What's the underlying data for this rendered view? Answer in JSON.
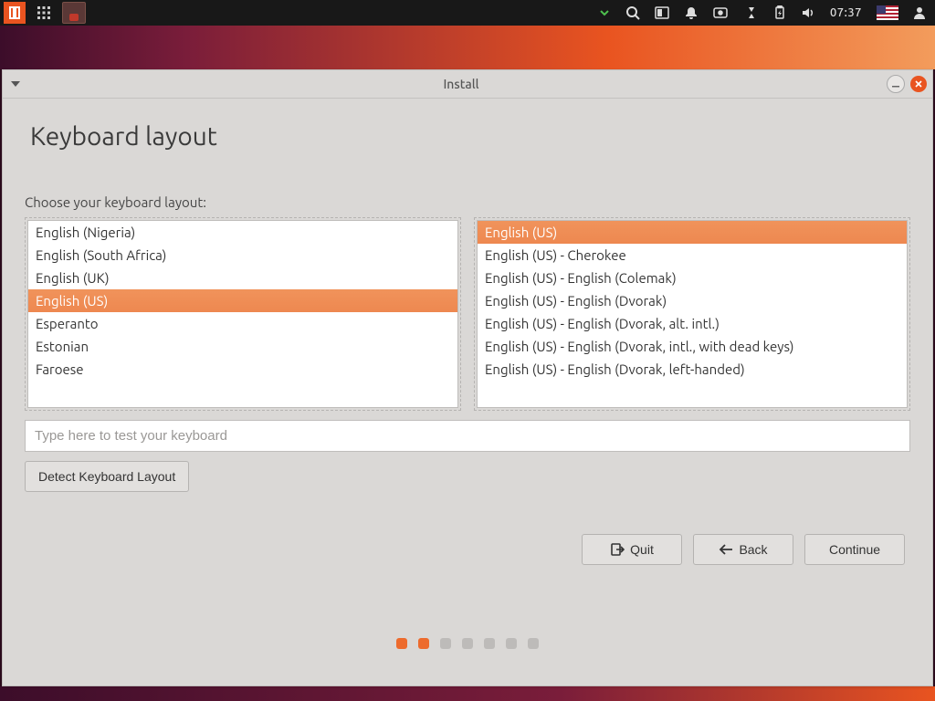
{
  "panel": {
    "clock": "07:37"
  },
  "window": {
    "title": "Install"
  },
  "page": {
    "heading": "Keyboard layout",
    "prompt": "Choose your keyboard layout:",
    "test_placeholder": "Type here to test your keyboard",
    "detect_label": "Detect Keyboard Layout"
  },
  "layouts": {
    "selected_index": 3,
    "items": [
      "English (Nigeria)",
      "English (South Africa)",
      "English (UK)",
      "English (US)",
      "Esperanto",
      "Estonian",
      "Faroese"
    ]
  },
  "variants": {
    "selected_index": 0,
    "items": [
      "English (US)",
      "English (US) - Cherokee",
      "English (US) - English (Colemak)",
      "English (US) - English (Dvorak)",
      "English (US) - English (Dvorak, alt. intl.)",
      "English (US) - English (Dvorak, intl., with dead keys)",
      "English (US) - English (Dvorak, left-handed)"
    ]
  },
  "nav": {
    "quit": "Quit",
    "back": "Back",
    "continue": "Continue"
  },
  "pager": {
    "total": 7,
    "active": [
      0,
      1
    ]
  },
  "colors": {
    "accent": "#e95420",
    "selection": "#ef8c55"
  }
}
